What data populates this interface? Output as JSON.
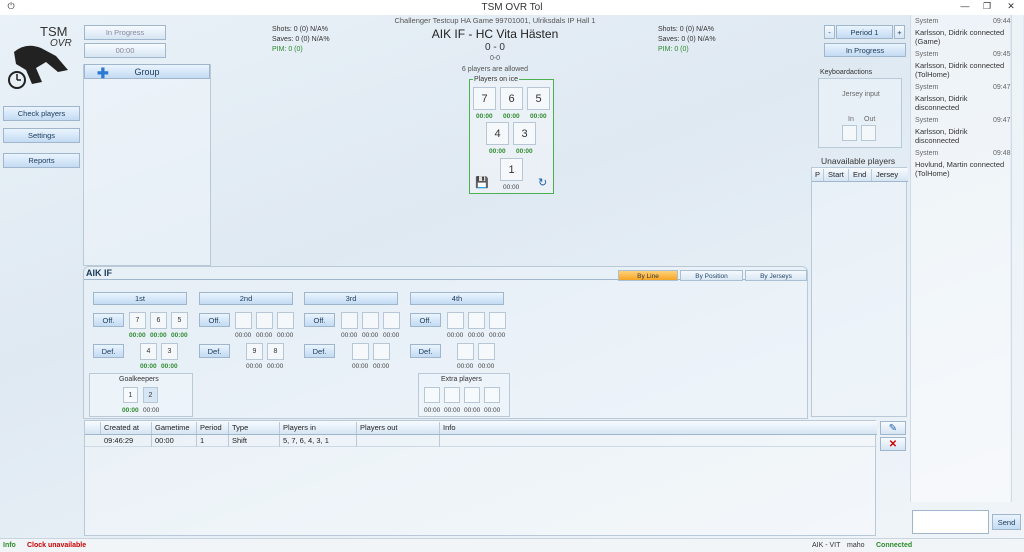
{
  "window": {
    "title": "TSM OVR Tol",
    "min": "—",
    "restore": "❐",
    "close": "✕"
  },
  "logo": {
    "line1": "TSM",
    "line2": "OVR"
  },
  "status": {
    "progress": "In Progress",
    "clock": "00:00"
  },
  "nav": [
    {
      "label": "Check players"
    },
    {
      "label": "Settings"
    },
    {
      "label": "Reports"
    }
  ],
  "group": {
    "label": "Group"
  },
  "game": {
    "info": "Challenger Testcup HA Game 99701001, Ulriksdals IP Hall 1",
    "title": "AIK IF - HC Vita Hästen",
    "score": "0 - 0",
    "period_score": "0-0",
    "allowed": "6 players are allowed"
  },
  "home_stats": {
    "shots": "Shots: 0 (0) N/A%",
    "saves": "Saves: 0 (0) N/A%",
    "pim": "PIM: 0 (0)"
  },
  "away_stats": {
    "shots": "Shots: 0 (0) N/A%",
    "saves": "Saves: 0 (0) N/A%",
    "pim": "PIM: 0 (0)"
  },
  "players_on_ice": {
    "label": "Players on ice",
    "row1": [
      {
        "n": "7",
        "t": "00:00"
      },
      {
        "n": "6",
        "t": "00:00"
      },
      {
        "n": "5",
        "t": "00:00"
      }
    ],
    "row2": [
      {
        "n": "4",
        "t": "00:00"
      },
      {
        "n": "3",
        "t": "00:00"
      }
    ],
    "goalie": {
      "n": "1",
      "t": "00:00"
    }
  },
  "period": {
    "minus": "-",
    "label": "Period 1",
    "plus": "+",
    "progress": "In Progress"
  },
  "keyboard": {
    "title": "Keyboardactions",
    "jersey": "Jersey input",
    "in": "In",
    "out": "Out"
  },
  "unavailable": {
    "title": "Unavailable players",
    "cols": [
      "P",
      "Start",
      "End",
      "Jersey"
    ]
  },
  "team": {
    "name": "AIK IF"
  },
  "tabs": [
    "By Line",
    "By Position",
    "By Jerseys"
  ],
  "lines": [
    {
      "name": "1st",
      "off": "Off.",
      "def": "Def.",
      "off_players": [
        "7",
        "6",
        "5"
      ],
      "off_times": [
        "00:00",
        "00:00",
        "00:00"
      ],
      "def_players": [
        "4",
        "3"
      ],
      "def_times": [
        "00:00",
        "00:00"
      ]
    },
    {
      "name": "2nd",
      "off": "Off.",
      "def": "Def.",
      "off_players": [
        "",
        "",
        ""
      ],
      "off_times": [
        "00:00",
        "00:00",
        "00:00"
      ],
      "def_players": [
        "9",
        "8"
      ],
      "def_times": [
        "00:00",
        "00:00"
      ]
    },
    {
      "name": "3rd",
      "off": "Off.",
      "def": "Def.",
      "off_players": [
        "",
        "",
        ""
      ],
      "off_times": [
        "00:00",
        "00:00",
        "00:00"
      ],
      "def_players": [
        "",
        ""
      ],
      "def_times": [
        "00:00",
        "00:00"
      ]
    },
    {
      "name": "4th",
      "off": "Off.",
      "def": "Def.",
      "off_players": [
        "",
        "",
        ""
      ],
      "off_times": [
        "00:00",
        "00:00",
        "00:00"
      ],
      "def_players": [
        "",
        ""
      ],
      "def_times": [
        "00:00",
        "00:00"
      ]
    }
  ],
  "goalkeepers": {
    "label": "Goalkeepers",
    "players": [
      "1",
      "2"
    ],
    "times": [
      "00:00",
      "00:00"
    ]
  },
  "extra": {
    "label": "Extra players",
    "times": [
      "00:00",
      "00:00",
      "00:00",
      "00:00"
    ]
  },
  "events": {
    "cols": [
      "Created at",
      "Gametime",
      "Period",
      "Type",
      "Players in",
      "Players out",
      "Info"
    ],
    "rows": [
      [
        "09:46:29",
        "00:00",
        "1",
        "Shift",
        "5, 7, 6, 4, 3, 1",
        "",
        ""
      ]
    ]
  },
  "log": [
    {
      "who": "System",
      "time": "09:44",
      "msg": "Karlsson, Didrik connected (Game)"
    },
    {
      "who": "System",
      "time": "09:45",
      "msg": "Karlsson, Didrik connected (TolHome)"
    },
    {
      "who": "System",
      "time": "09:47",
      "msg": "Karlsson, Didrik disconnected"
    },
    {
      "who": "System",
      "time": "09:47",
      "msg": "Karlsson, Didrik disconnected"
    },
    {
      "who": "System",
      "time": "09:48",
      "msg": "Hovlund, Martin connected (TolHome)"
    }
  ],
  "send": {
    "label": "Send",
    "value": ""
  },
  "statusbar": {
    "info": "Info",
    "clock": "Clock unavailable",
    "teams": "AIK - VIT",
    "user": "maho",
    "conn": "Connected"
  },
  "colors": {
    "accent": "#f5a623",
    "green": "#2e8b2e",
    "red": "#cc0000",
    "navy": "#1a3a5a"
  }
}
